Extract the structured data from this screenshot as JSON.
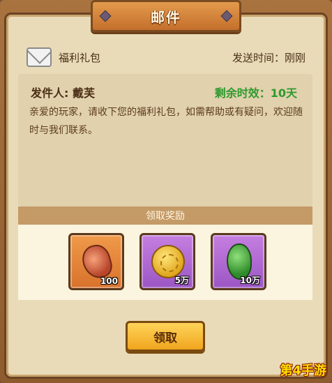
{
  "window": {
    "title": "邮件"
  },
  "mail": {
    "subject": "福利礼包",
    "send_time": "发送时间：刚刚",
    "sender": "发件人: 戴芙",
    "remaining": "剩余时效：10天",
    "body": "亲爱的玩家，请收下您的福利礼包，如需帮助或有疑问，欢迎随时与我们联系。"
  },
  "rewards": {
    "header": "领取奖励",
    "items": [
      {
        "icon": "red-leaf-icon",
        "count": "100",
        "frame_color": "#e27a34"
      },
      {
        "icon": "gold-coin-icon",
        "count": "5万",
        "frame_color": "#a864cf"
      },
      {
        "icon": "green-bean-icon",
        "count": "10万",
        "frame_color": "#a864cf"
      }
    ]
  },
  "actions": {
    "claim_label": "领取"
  },
  "watermark": "第4手游",
  "colors": {
    "accent_orange": "#e39a4c",
    "timer_green": "#2e9a2e",
    "panel_bg": "#e9dbb8"
  }
}
